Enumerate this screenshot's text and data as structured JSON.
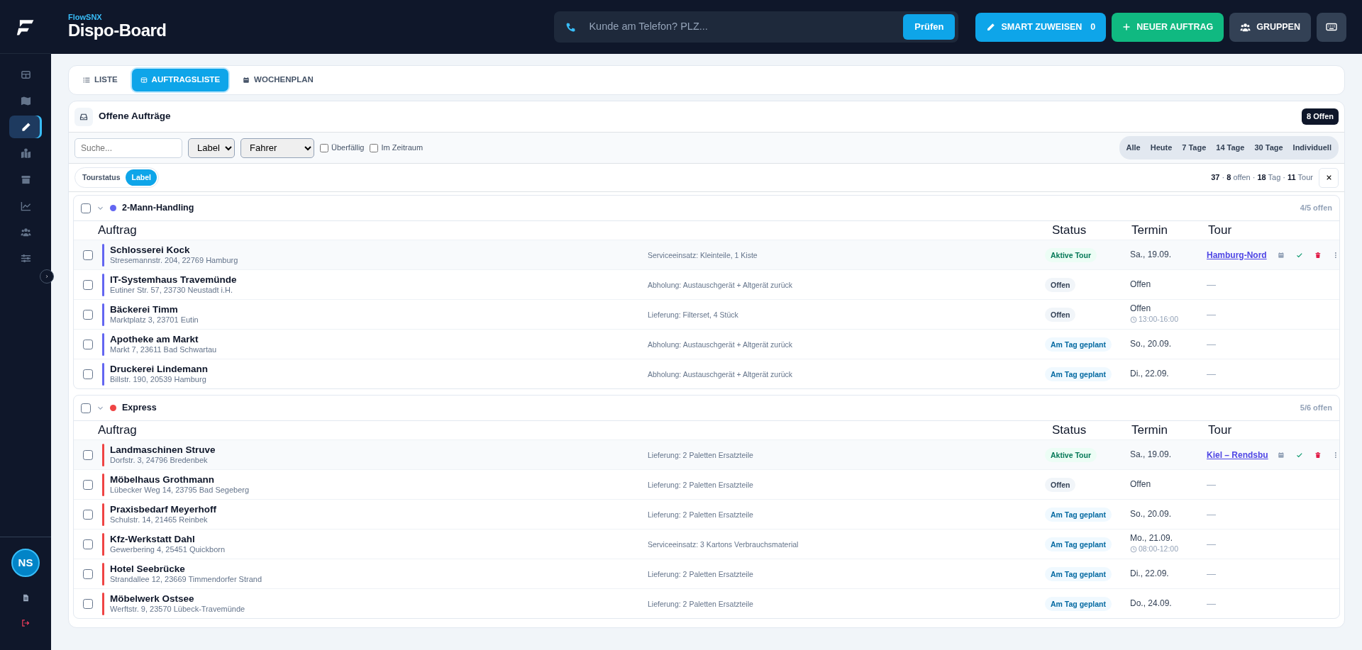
{
  "brand": {
    "app": "FlowSNX",
    "title": "Dispo-Board"
  },
  "sidebar": {
    "items": [
      {
        "selected": false
      },
      {
        "selected": false
      },
      {
        "selected": true
      },
      {
        "selected": false
      },
      {
        "selected": false
      },
      {
        "selected": false
      },
      {
        "selected": false
      },
      {
        "selected": false
      }
    ],
    "avatar": "NS"
  },
  "phone_search": {
    "placeholder": "Kunde am Telefon? PLZ...",
    "button": "Prüfen"
  },
  "actions": [
    {
      "kind": "smart",
      "label": "SMART ZUWEISEN",
      "count": "0"
    },
    {
      "kind": "new",
      "label": "NEUER AUFTRAG"
    },
    {
      "kind": "groups",
      "label": "GRUPPEN"
    },
    {
      "kind": "keyboard"
    }
  ],
  "view_tabs": [
    {
      "label": "LISTE",
      "selected": false
    },
    {
      "label": "AUFTRAGSLISTE",
      "selected": true
    },
    {
      "label": "WOCHENPLAN",
      "selected": false
    }
  ],
  "panel": {
    "title": "Offene Aufträge",
    "badge": "8 Offen",
    "search_placeholder": "Suche...",
    "label_select": "Label",
    "driver_select": "Fahrer",
    "checks": [
      {
        "label": "Überfällig",
        "checked": false
      },
      {
        "label": "Im Zeitraum",
        "checked": false
      }
    ],
    "ranges": [
      {
        "label": "Alle",
        "selected": false
      },
      {
        "label": "Heute",
        "selected": false
      },
      {
        "label": "7 Tage",
        "selected": false
      },
      {
        "label": "14 Tage",
        "selected": false
      },
      {
        "label": "30 Tage",
        "selected": false
      },
      {
        "label": "Individuell",
        "selected": false
      }
    ],
    "grouping": [
      {
        "label": "Tourstatus",
        "selected": false
      },
      {
        "label": "Label",
        "selected": true
      }
    ],
    "summary": "**37** · **8** offen · **18** Tag · **11** Tour"
  },
  "groups": [
    {
      "name": "2-Mann-Handling",
      "color": "#6366f1",
      "checked": false,
      "expanded": true,
      "count": "4/5 offen",
      "columns": [
        "Auftrag",
        "Status",
        "Termin",
        "Tour"
      ],
      "orders": [
        {
          "name": "Schlosserei Kock",
          "address": "Stresemannstr. 204, 22769 Hamburg",
          "description": "Serviceeinsatz: Kleinteile, 1 Kiste",
          "status": {
            "kind": "active",
            "label": "Aktive Tour"
          },
          "date": "Sa., 19.09.",
          "tour": "Hamburg-Nord",
          "tour_assigned": true,
          "checked": false
        },
        {
          "name": "IT-Systemhaus Travemünde",
          "address": "Eutiner Str. 57, 23730 Neustadt i.H.",
          "description": "Abholung: Austauschgerät + Altgerät zurück",
          "status": {
            "kind": "open",
            "label": "Offen"
          },
          "date": "Offen",
          "tour": "—",
          "tour_assigned": false,
          "checked": false
        },
        {
          "name": "Bäckerei Timm",
          "address": "Marktplatz 3, 23701 Eutin",
          "description": "Lieferung: Filterset, 4 Stück",
          "status": {
            "kind": "open",
            "label": "Offen"
          },
          "date": "Offen",
          "time": "13:00-16:00",
          "tour": "—",
          "tour_assigned": false,
          "checked": false
        },
        {
          "name": "Apotheke am Markt",
          "address": "Markt 7, 23611 Bad Schwartau",
          "description": "Abholung: Austauschgerät + Altgerät zurück",
          "status": {
            "kind": "planned",
            "label": "Am Tag geplant"
          },
          "date": "So., 20.09.",
          "tour": "—",
          "tour_assigned": false,
          "checked": false
        },
        {
          "name": "Druckerei Lindemann",
          "address": "Billstr. 190, 20539 Hamburg",
          "description": "Abholung: Austauschgerät + Altgerät zurück",
          "status": {
            "kind": "planned",
            "label": "Am Tag geplant"
          },
          "date": "Di., 22.09.",
          "tour": "—",
          "tour_assigned": false,
          "checked": false
        }
      ]
    },
    {
      "name": "Express",
      "color": "#ef4444",
      "checked": false,
      "expanded": true,
      "count": "5/6 offen",
      "columns": [
        "Auftrag",
        "Status",
        "Termin",
        "Tour"
      ],
      "orders": [
        {
          "name": "Landmaschinen Struve",
          "address": "Dorfstr. 3, 24796 Bredenbek",
          "description": "Lieferung: 2 Paletten Ersatzteile",
          "status": {
            "kind": "active",
            "label": "Aktive Tour"
          },
          "date": "Sa., 19.09.",
          "tour": "Kiel – Rendsbu",
          "tour_assigned": true,
          "checked": false
        },
        {
          "name": "Möbelhaus Grothmann",
          "address": "Lübecker Weg 14, 23795 Bad Segeberg",
          "description": "Lieferung: 2 Paletten Ersatzteile",
          "status": {
            "kind": "open",
            "label": "Offen"
          },
          "date": "Offen",
          "tour": "—",
          "tour_assigned": false,
          "checked": false
        },
        {
          "name": "Praxisbedarf Meyerhoff",
          "address": "Schulstr. 14, 21465 Reinbek",
          "description": "Lieferung: 2 Paletten Ersatzteile",
          "status": {
            "kind": "planned",
            "label": "Am Tag geplant"
          },
          "date": "So., 20.09.",
          "tour": "—",
          "tour_assigned": false,
          "checked": false
        },
        {
          "name": "Kfz-Werkstatt Dahl",
          "address": "Gewerbering 4, 25451 Quickborn",
          "description": "Serviceeinsatz: 3 Kartons Verbrauchsmaterial",
          "status": {
            "kind": "planned",
            "label": "Am Tag geplant"
          },
          "date": "Mo., 21.09.",
          "time": "08:00-12:00",
          "tour": "—",
          "tour_assigned": false,
          "checked": false
        },
        {
          "name": "Hotel Seebrücke",
          "address": "Strandallee 12, 23669 Timmendorfer Strand",
          "description": "Lieferung: 2 Paletten Ersatzteile",
          "status": {
            "kind": "planned",
            "label": "Am Tag geplant"
          },
          "date": "Di., 22.09.",
          "tour": "—",
          "tour_assigned": false,
          "checked": false
        },
        {
          "name": "Möbelwerk Ostsee",
          "address": "Werftstr. 9, 23570 Lübeck-Travemünde",
          "description": "Lieferung: 2 Paletten Ersatzteile",
          "status": {
            "kind": "planned",
            "label": "Am Tag geplant"
          },
          "date": "Do., 24.09.",
          "tour": "—",
          "tour_assigned": false,
          "checked": false
        }
      ]
    }
  ]
}
